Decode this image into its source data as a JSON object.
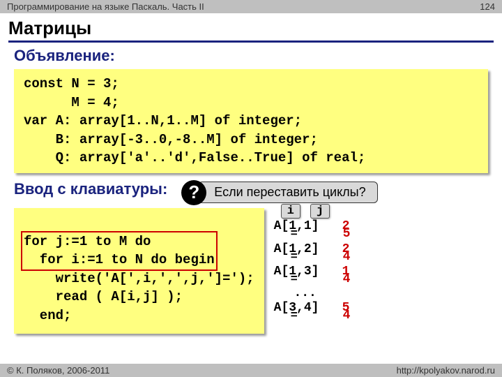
{
  "header": {
    "breadcrumb": "Программирование на языке Паскаль. Часть II",
    "page": "124"
  },
  "title": "Матрицы",
  "section1": "Объявление:",
  "code1": "const N = 3;\n      M = 4;\nvar A: array[1..N,1..M] of integer;\n    B: array[-3..0,-8..M] of integer;\n    Q: array['a'..'d',False..True] of real;",
  "section2": "Ввод с клавиатуры:",
  "callout": {
    "mark": "?",
    "text": "Если переставить циклы?"
  },
  "code2_l1": "for j:=1 to M do",
  "code2_l2": "  for i:=1 to N do begin",
  "code2_l3": "    write('A[',i,',',j,']=');",
  "code2_l4": "    read ( A[i,j] );",
  "code2_l5": "  end;",
  "chips": {
    "i": "i",
    "j": "j"
  },
  "output": {
    "r1a": "A[1,1]",
    "r1v": "2",
    "r1b": "=",
    "r1w": "5",
    "r2a": "A[1,2]",
    "r2v": "2",
    "r2b": "=",
    "r2w": "4",
    "r3a": "A[1,3]",
    "r3v": "1",
    "r3b": "=",
    "r3w": "4",
    "dots": "...",
    "r4a": "A[3,4]",
    "r4v": "5",
    "r4b": "=",
    "r4w": "4"
  },
  "footer": {
    "copyright": "© К. Поляков, 2006-2011",
    "url": "http://kpolyakov.narod.ru"
  }
}
